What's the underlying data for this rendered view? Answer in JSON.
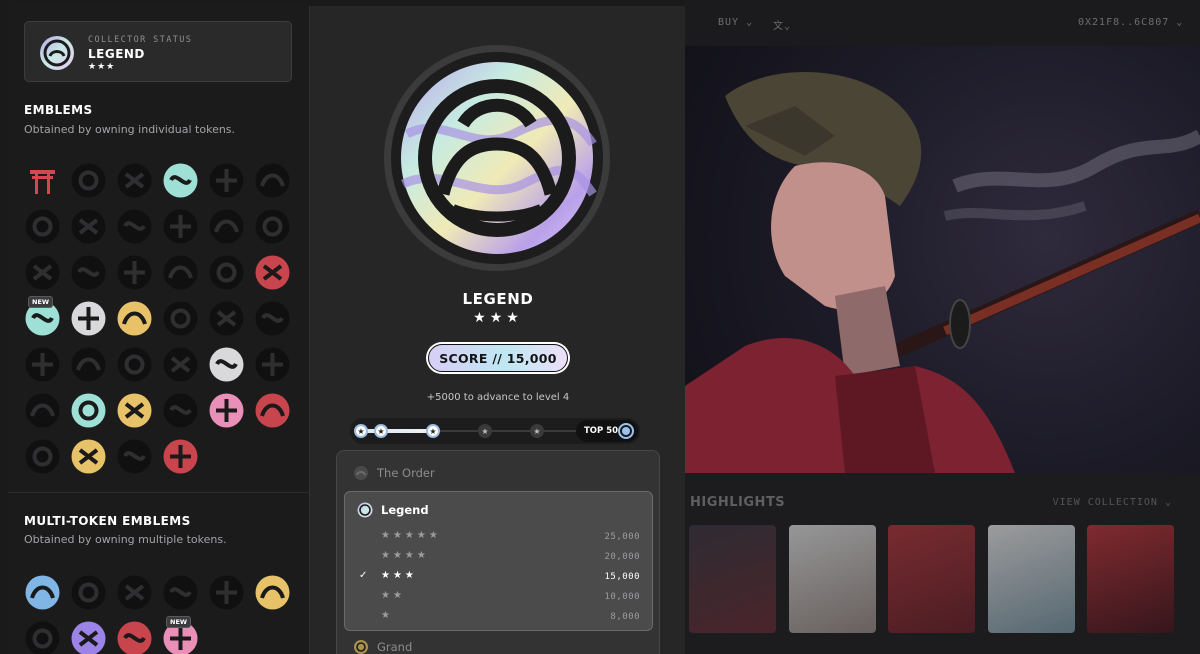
{
  "nav": {
    "buy": "BUY",
    "translate_icon": "translate-icon",
    "wallet": "0X21F8..6C807"
  },
  "highlights": {
    "title": "HIGHLIGHTS",
    "view_collection": "VIEW COLLECTION"
  },
  "collector_status": {
    "label": "COLLECTOR STATUS",
    "name": "LEGEND",
    "stars": "★★★"
  },
  "emblems": {
    "title": "EMBLEMS",
    "subtitle": "Obtained by owning individual tokens.",
    "new_badge": "NEW"
  },
  "multi_token_emblems": {
    "title": "MULTI-TOKEN EMBLEMS",
    "subtitle": "Obtained by owning multiple tokens.",
    "new_badge": "NEW"
  },
  "level": {
    "name": "LEGEND",
    "stars": "★★★",
    "score_label": "SCORE // 15,000",
    "advance_text": "+5000 to advance to level 4",
    "progress_fraction": 0.25,
    "top_badge": "TOP 50"
  },
  "ranks": {
    "order_group": "The Order",
    "selected_group": "Legend",
    "next_group": "Grand",
    "tiers": [
      {
        "stars": "★★★★★",
        "score": "25,000",
        "active": false,
        "checked": false
      },
      {
        "stars": "★★★★",
        "score": "20,000",
        "active": false,
        "checked": false
      },
      {
        "stars": "★★★",
        "score": "15,000",
        "active": true,
        "checked": true
      },
      {
        "stars": "★★",
        "score": "10,000",
        "active": false,
        "checked": false
      },
      {
        "stars": "★",
        "score": "8,000",
        "active": false,
        "checked": false
      }
    ],
    "check_mark": "✓"
  }
}
